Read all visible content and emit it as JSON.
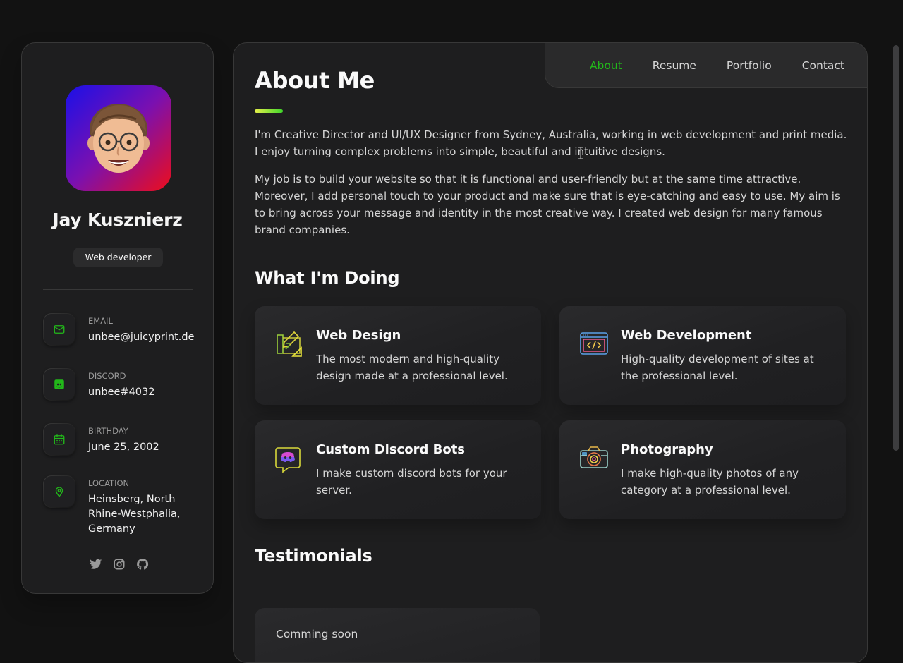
{
  "profile": {
    "name": "Jay Kusznierz",
    "title": "Web developer",
    "avatar": "memoji-avatar"
  },
  "contacts": [
    {
      "label": "Email",
      "value": "unbee@juicyprint.de",
      "icon": "mail-icon"
    },
    {
      "label": "Discord",
      "value": "unbee#4032",
      "icon": "discord-icon"
    },
    {
      "label": "Birthday",
      "value": "June 25, 2002",
      "icon": "calendar-icon"
    },
    {
      "label": "Location",
      "value": "Heinsberg, North Rhine-Westphalia, Germany",
      "icon": "location-pin-icon"
    }
  ],
  "socials": [
    "twitter-icon",
    "instagram-icon",
    "github-icon"
  ],
  "nav": {
    "items": [
      "About",
      "Resume",
      "Portfolio",
      "Contact"
    ],
    "active": "About"
  },
  "about": {
    "heading": "About Me",
    "paragraphs": [
      "I'm Creative Director and UI/UX Designer from Sydney, Australia, working in web development and print media. I enjoy turning complex problems into simple, beautiful and intuitive designs.",
      "My job is to build your website so that it is functional and user-friendly but at the same time attractive. Moreover, I add personal touch to your product and make sure that is eye-catching and easy to use. My aim is to bring across your message and identity in the most creative way. I created web design for many famous brand companies."
    ]
  },
  "services": {
    "heading": "What I'm Doing",
    "items": [
      {
        "title": "Web Design",
        "text": "The most modern and high-quality design made at a professional level.",
        "icon": "design-icon"
      },
      {
        "title": "Web Development",
        "text": "High-quality development of sites at the professional level.",
        "icon": "code-icon"
      },
      {
        "title": "Custom Discord Bots",
        "text": "I make custom discord bots for your server.",
        "icon": "discord-bot-icon"
      },
      {
        "title": "Photography",
        "text": "I make high-quality photos of any category at a professional level.",
        "icon": "camera-icon"
      }
    ]
  },
  "testimonials": {
    "heading": "Testimonials",
    "placeholder": "Comming soon"
  },
  "colors": {
    "accent": "#22b81a",
    "background": "#121212",
    "card": "#1e1e1f"
  }
}
